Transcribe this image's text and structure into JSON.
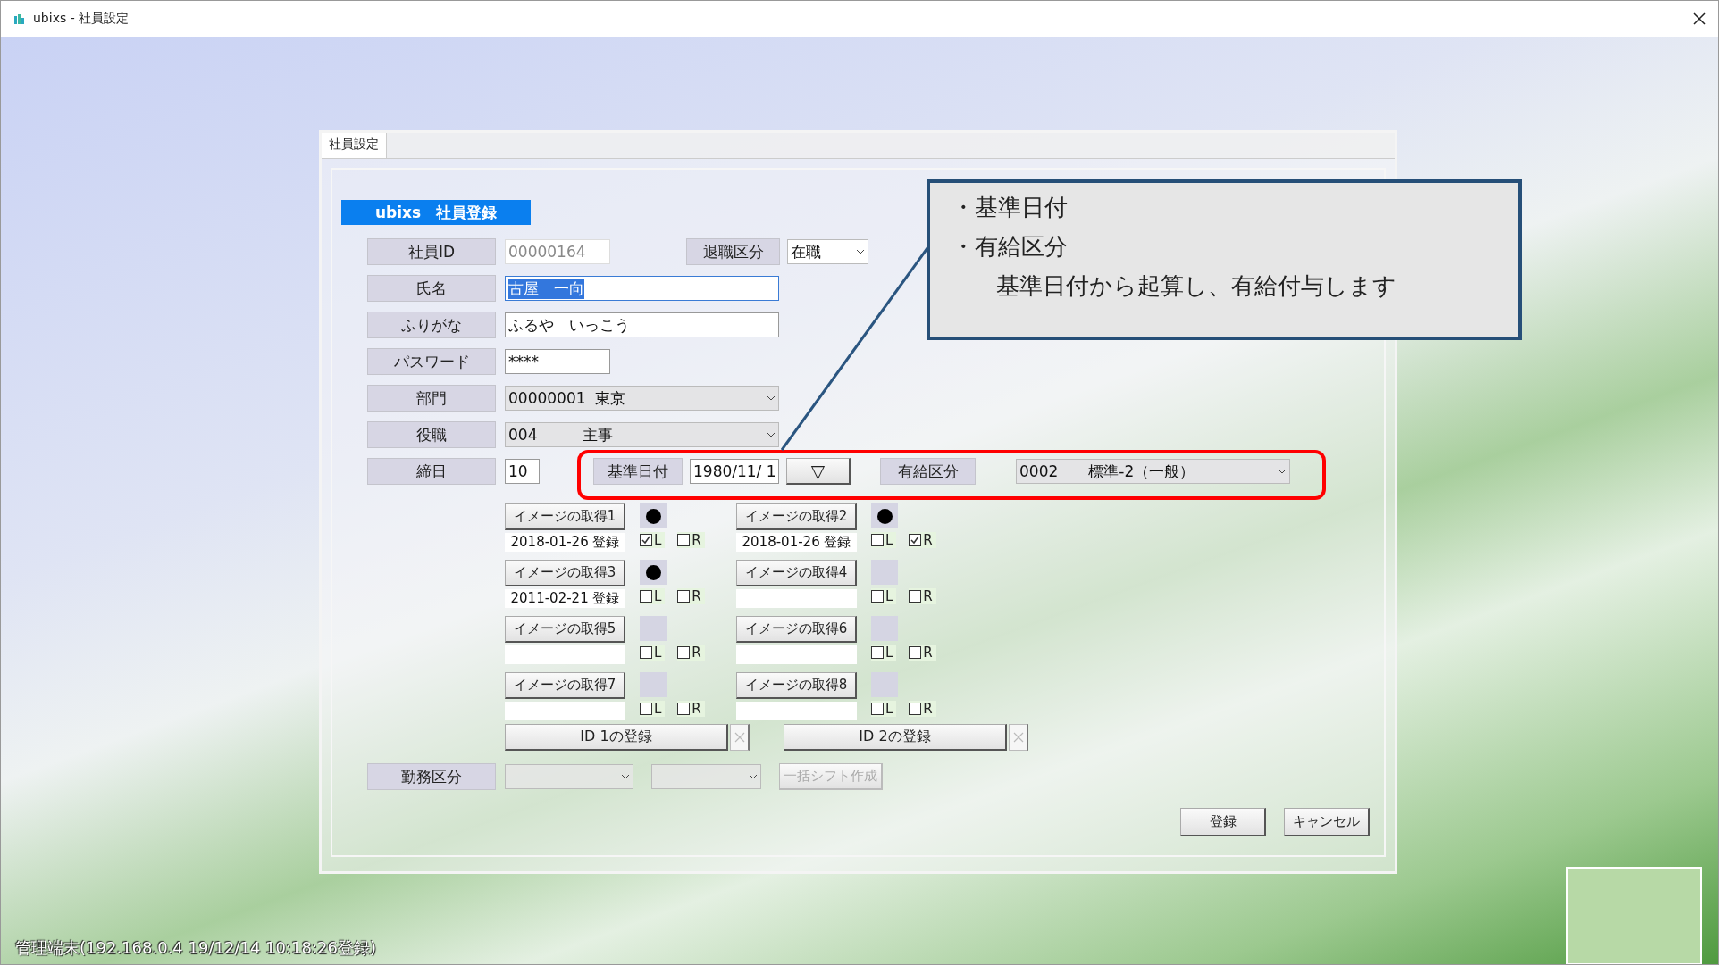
{
  "window": {
    "title": "ubixs - 社員設定"
  },
  "tabs": [
    {
      "label": "社員設定",
      "selected": true
    }
  ],
  "header": "ubixs　社員登録",
  "employee_id": {
    "label": "社員ID",
    "value": "00000164",
    "disabled": true
  },
  "retirement": {
    "label": "退職区分",
    "value": "在職"
  },
  "name": {
    "label": "氏名",
    "value": "古屋　一向",
    "text_selected": true
  },
  "furigana": {
    "label": "ふりがな",
    "value": "ふるや　いっこう"
  },
  "password": {
    "label": "パスワード",
    "value": "****"
  },
  "department": {
    "label": "部門",
    "value": "00000001  東京"
  },
  "position": {
    "label": "役職",
    "value": "004　　　主事"
  },
  "closing_day": {
    "label": "締日",
    "value": "10"
  },
  "base_date": {
    "label": "基準日付",
    "value": "1980/11/ 1",
    "button": "▽"
  },
  "paid_leave": {
    "label": "有給区分",
    "value": "0002　　標準-2（一般）"
  },
  "images": [
    {
      "button": "イメージの取得1",
      "date": "2018-01-26 登録",
      "has_image": true,
      "left": true,
      "right": false,
      "l_label": "L",
      "r_label": "R"
    },
    {
      "button": "イメージの取得2",
      "date": "2018-01-26 登録",
      "has_image": true,
      "left": false,
      "right": true,
      "l_label": "L",
      "r_label": "R"
    },
    {
      "button": "イメージの取得3",
      "date": "2011-02-21 登録",
      "has_image": true,
      "left": false,
      "right": false,
      "l_label": "L",
      "r_label": "R"
    },
    {
      "button": "イメージの取得4",
      "has_image": false,
      "left": false,
      "right": false,
      "l_label": "L",
      "r_label": "R"
    },
    {
      "button": "イメージの取得5",
      "has_image": false,
      "left": false,
      "right": false,
      "l_label": "L",
      "r_label": "R"
    },
    {
      "button": "イメージの取得6",
      "has_image": false,
      "left": false,
      "right": false,
      "l_label": "L",
      "r_label": "R"
    },
    {
      "button": "イメージの取得7",
      "has_image": false,
      "left": false,
      "right": false,
      "l_label": "L",
      "r_label": "R"
    },
    {
      "button": "イメージの取得8",
      "has_image": false,
      "left": false,
      "right": false,
      "l_label": "L",
      "r_label": "R"
    }
  ],
  "id_buttons": [
    {
      "label": "ID  1の登録"
    },
    {
      "label": "ID  2の登録"
    }
  ],
  "work_type": {
    "label": "勤務区分",
    "button": "一括シフト作成",
    "disabled": true
  },
  "actions": [
    "登録",
    "キャンセル"
  ],
  "callout": {
    "lines": [
      "・基準日付",
      "・有給区分",
      "基準日付から起算し、有給付与します"
    ]
  },
  "status_bar": "管理端末(192.168.0.4 19/12/14 10:18:26登録)"
}
